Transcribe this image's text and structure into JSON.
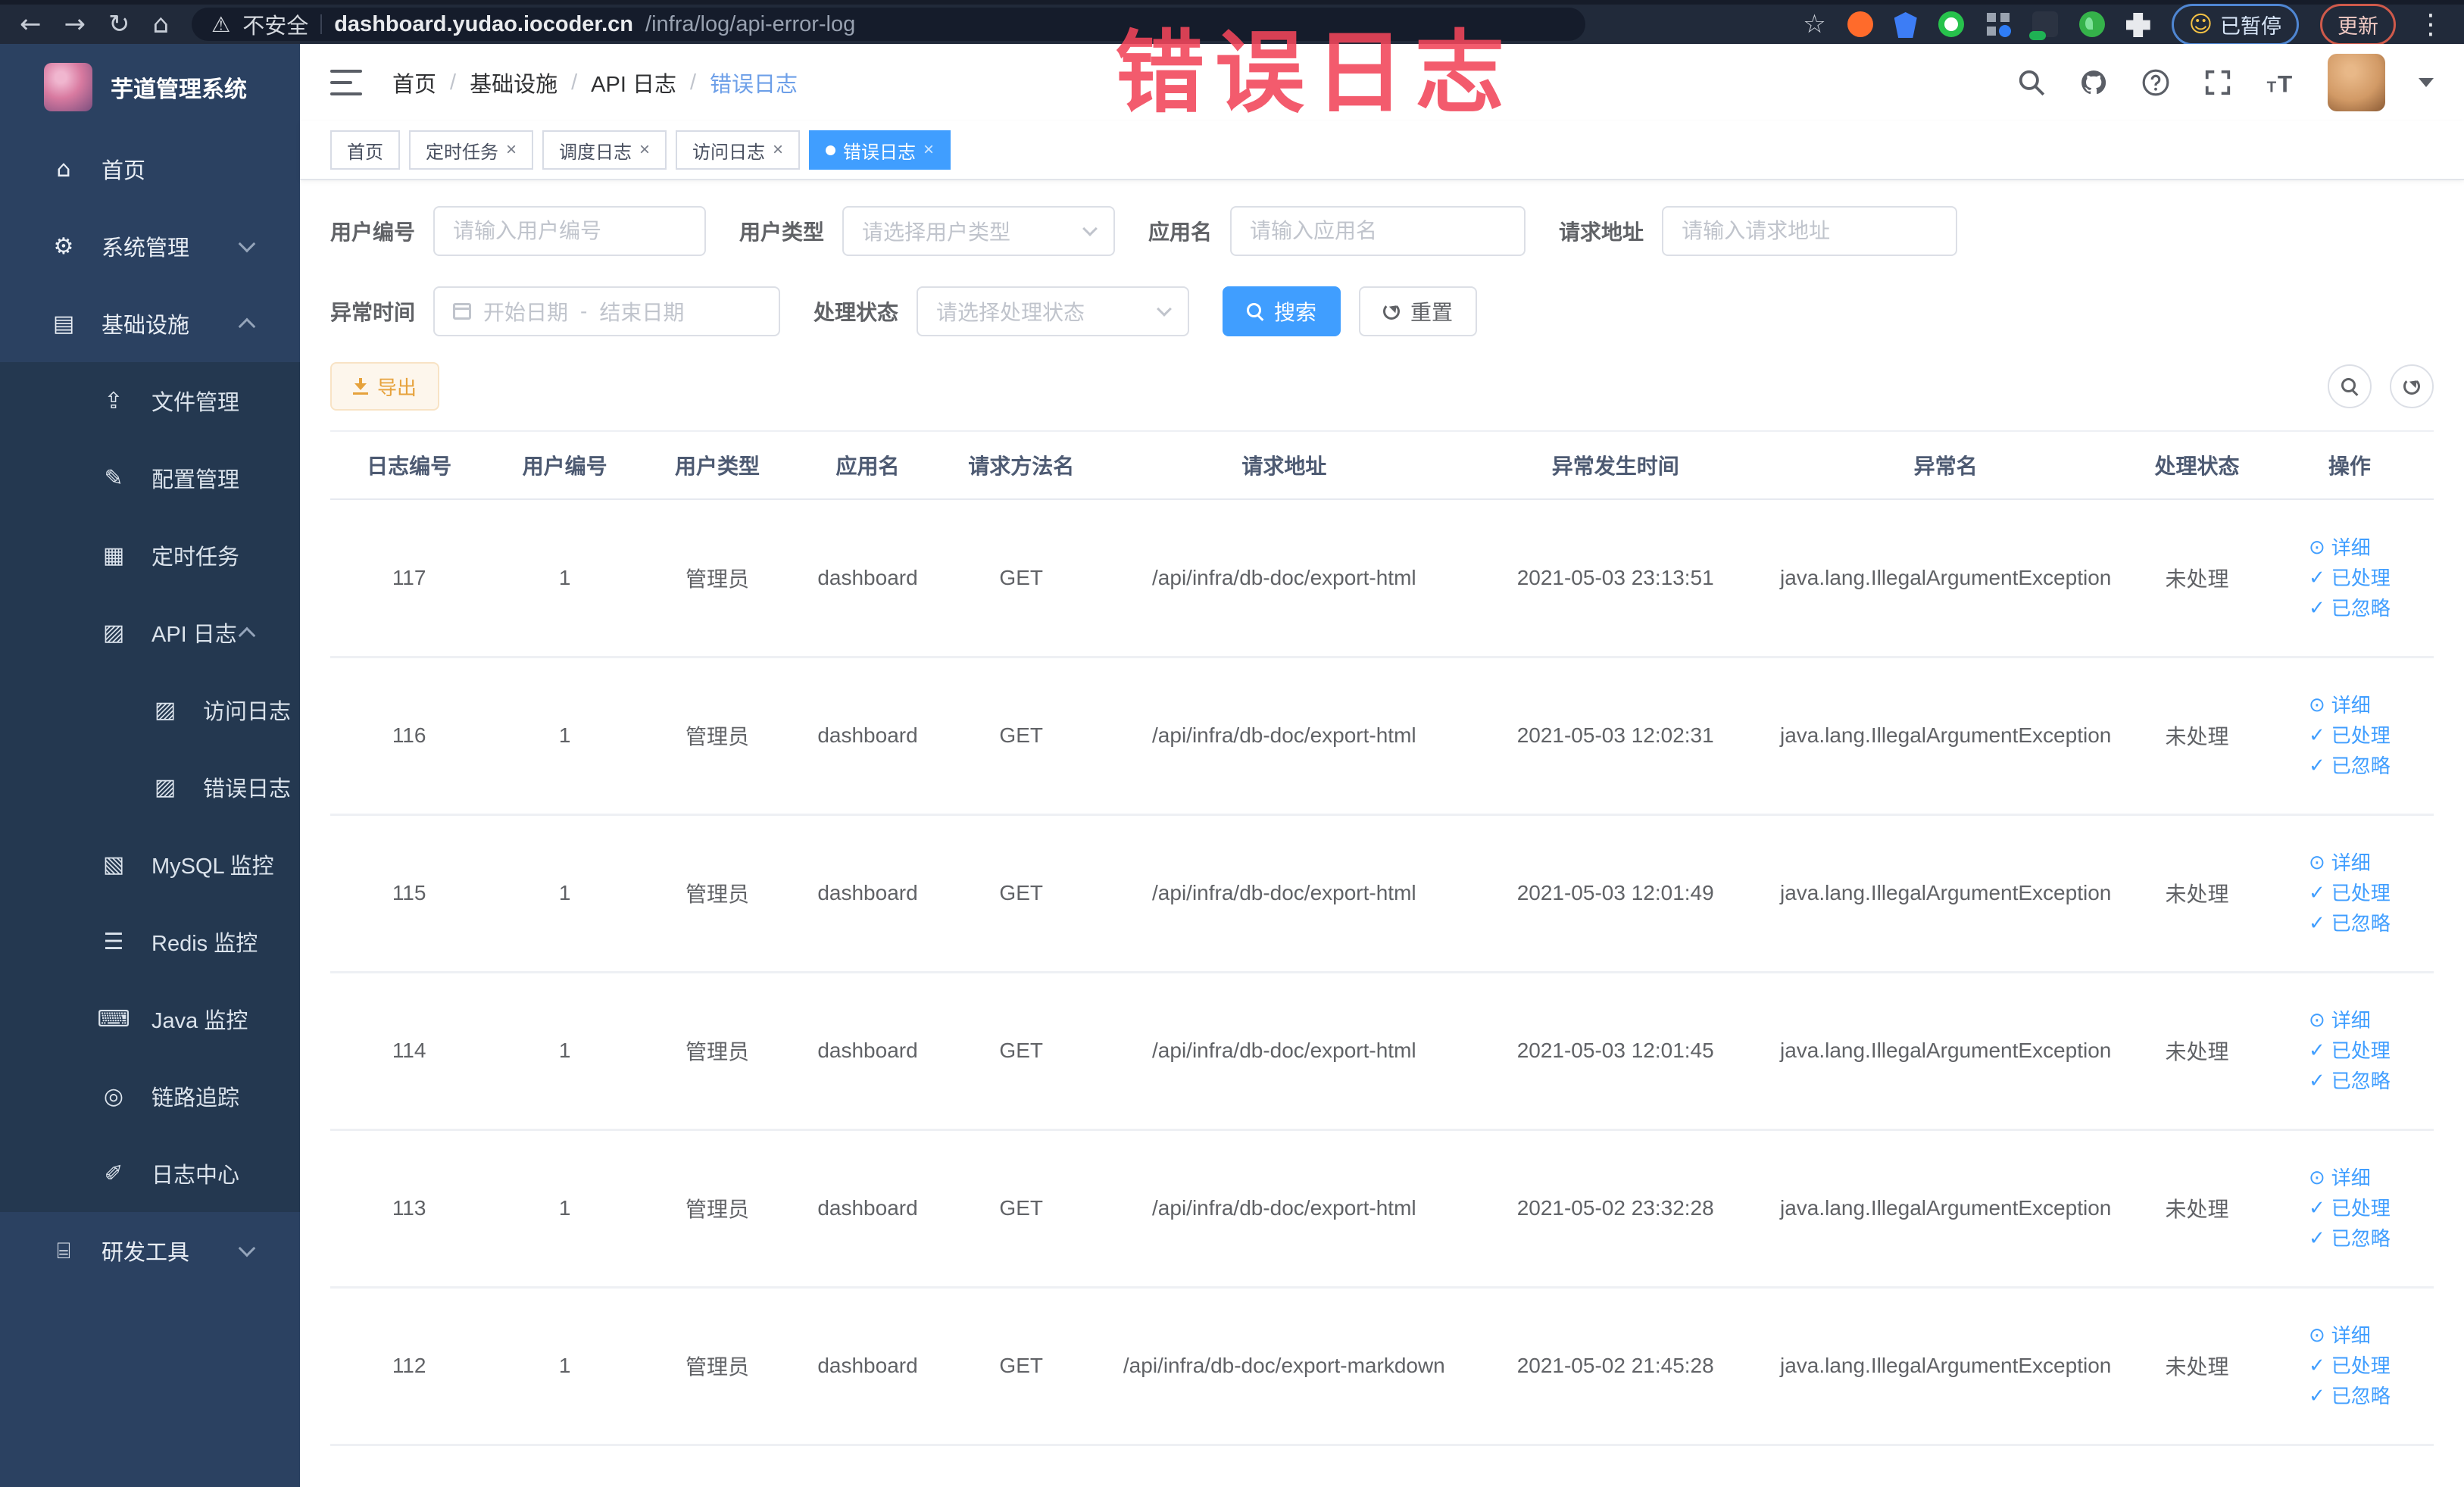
{
  "browser": {
    "security_label": "不安全",
    "url_domain": "dashboard.yudao.iocoder.cn",
    "url_path": "/infra/log/api-error-log",
    "paused_badge": "已暂停",
    "update_label": "更新"
  },
  "overlay_annotation": {
    "text": "错误日志",
    "color": "#f2455a"
  },
  "sidebar": {
    "logo_title": "芋道管理系统",
    "menu": [
      {
        "label": "首页",
        "level": 0,
        "glyph": "⌂",
        "icon": "home-icon"
      },
      {
        "label": "系统管理",
        "level": 0,
        "glyph": "⚙",
        "icon": "gear-icon",
        "chevron": "down"
      },
      {
        "label": "基础设施",
        "level": 0,
        "glyph": "▤",
        "icon": "infrastructure-icon",
        "chevron": "up"
      },
      {
        "label": "文件管理",
        "level": 1,
        "glyph": "⇪",
        "icon": "file-manage-icon",
        "dark": true
      },
      {
        "label": "配置管理",
        "level": 1,
        "glyph": "✎",
        "icon": "config-manage-icon",
        "dark": true
      },
      {
        "label": "定时任务",
        "level": 1,
        "glyph": "▦",
        "icon": "cron-job-icon",
        "dark": true
      },
      {
        "label": "API 日志",
        "level": 1,
        "glyph": "▨",
        "icon": "api-log-icon",
        "dark": true,
        "chevron": "up"
      },
      {
        "label": "访问日志",
        "level": 2,
        "glyph": "▨",
        "icon": "access-log-icon",
        "dark": true
      },
      {
        "label": "错误日志",
        "level": 2,
        "glyph": "▨",
        "icon": "error-log-icon",
        "dark": true,
        "active": true
      },
      {
        "label": "MySQL 监控",
        "level": 1,
        "glyph": "▧",
        "icon": "mysql-monitor-icon",
        "dark": true
      },
      {
        "label": "Redis 监控",
        "level": 1,
        "glyph": "☰",
        "icon": "redis-monitor-icon",
        "dark": true
      },
      {
        "label": "Java 监控",
        "level": 1,
        "glyph": "⌨",
        "icon": "java-monitor-icon",
        "dark": true
      },
      {
        "label": "链路追踪",
        "level": 1,
        "glyph": "◎",
        "icon": "trace-icon",
        "dark": true
      },
      {
        "label": "日志中心",
        "level": 1,
        "glyph": "✐",
        "icon": "log-center-icon",
        "dark": true
      },
      {
        "label": "研发工具",
        "level": 0,
        "glyph": "⌸",
        "icon": "dev-tools-icon",
        "chevron": "down"
      }
    ]
  },
  "header": {
    "breadcrumb": [
      "首页",
      "基础设施",
      "API 日志",
      "错误日志"
    ]
  },
  "tags": [
    {
      "label": "首页"
    },
    {
      "label": "定时任务",
      "closable": true
    },
    {
      "label": "调度日志",
      "closable": true
    },
    {
      "label": "访问日志",
      "closable": true
    },
    {
      "label": "错误日志",
      "closable": true,
      "active": true
    }
  ],
  "filters": {
    "user_id_label": "用户编号",
    "user_id_placeholder": "请输入用户编号",
    "user_type_label": "用户类型",
    "user_type_placeholder": "请选择用户类型",
    "app_name_label": "应用名",
    "app_name_placeholder": "请输入应用名",
    "request_url_label": "请求地址",
    "request_url_placeholder": "请输入请求地址",
    "exception_time_label": "异常时间",
    "date_start_placeholder": "开始日期",
    "date_separator": "-",
    "date_end_placeholder": "结束日期",
    "process_status_label": "处理状态",
    "process_status_placeholder": "请选择处理状态",
    "search_button": "搜索",
    "reset_button": "重置"
  },
  "toolbar": {
    "export_button": "导出"
  },
  "table": {
    "columns": [
      "日志编号",
      "用户编号",
      "用户类型",
      "应用名",
      "请求方法名",
      "请求地址",
      "异常发生时间",
      "异常名",
      "处理状态",
      "操作"
    ],
    "actions": {
      "detail": "详细",
      "processed": "已处理",
      "ignored": "已忽略"
    },
    "rows": [
      {
        "id": "117",
        "user": "1",
        "type": "管理员",
        "app": "dashboard",
        "method": "GET",
        "url": "/api/infra/db-doc/export-html",
        "time": "2021-05-03 23:13:51",
        "exc": "java.lang.IllegalArgumentException",
        "status": "未处理"
      },
      {
        "id": "116",
        "user": "1",
        "type": "管理员",
        "app": "dashboard",
        "method": "GET",
        "url": "/api/infra/db-doc/export-html",
        "time": "2021-05-03 12:02:31",
        "exc": "java.lang.IllegalArgumentException",
        "status": "未处理"
      },
      {
        "id": "115",
        "user": "1",
        "type": "管理员",
        "app": "dashboard",
        "method": "GET",
        "url": "/api/infra/db-doc/export-html",
        "time": "2021-05-03 12:01:49",
        "exc": "java.lang.IllegalArgumentException",
        "status": "未处理"
      },
      {
        "id": "114",
        "user": "1",
        "type": "管理员",
        "app": "dashboard",
        "method": "GET",
        "url": "/api/infra/db-doc/export-html",
        "time": "2021-05-03 12:01:45",
        "exc": "java.lang.IllegalArgumentException",
        "status": "未处理"
      },
      {
        "id": "113",
        "user": "1",
        "type": "管理员",
        "app": "dashboard",
        "method": "GET",
        "url": "/api/infra/db-doc/export-html",
        "time": "2021-05-02 23:32:28",
        "exc": "java.lang.IllegalArgumentException",
        "status": "未处理"
      },
      {
        "id": "112",
        "user": "1",
        "type": "管理员",
        "app": "dashboard",
        "method": "GET",
        "url": "/api/infra/db-doc/export-markdown",
        "time": "2021-05-02 21:45:28",
        "exc": "java.lang.IllegalArgumentException",
        "status": "未处理"
      }
    ]
  }
}
